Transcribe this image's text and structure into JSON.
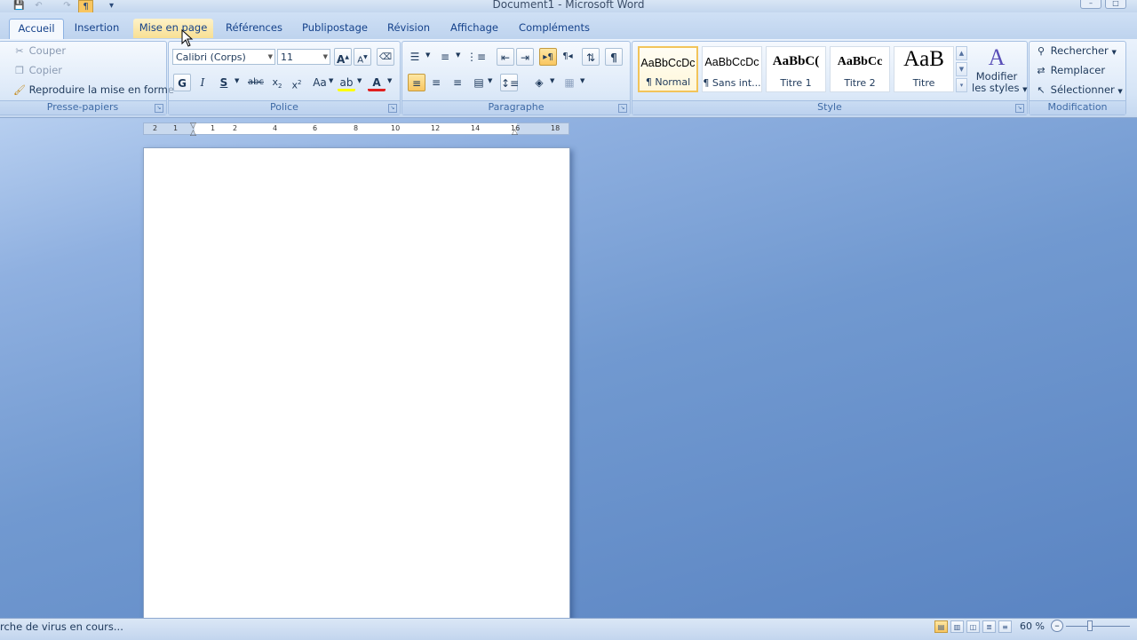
{
  "window": {
    "title": "Document1 - Microsoft Word"
  },
  "tabs": [
    {
      "label": "Accueil",
      "state": "active"
    },
    {
      "label": "Insertion",
      "state": "normal"
    },
    {
      "label": "Mise en page",
      "state": "hover"
    },
    {
      "label": "Références",
      "state": "normal"
    },
    {
      "label": "Publipostage",
      "state": "normal"
    },
    {
      "label": "Révision",
      "state": "normal"
    },
    {
      "label": "Affichage",
      "state": "normal"
    },
    {
      "label": "Compléments",
      "state": "normal"
    }
  ],
  "clipboard": {
    "label": "Presse-papiers",
    "cut": "Couper",
    "copy": "Copier",
    "format_painter": "Reproduire la mise en forme"
  },
  "font": {
    "label": "Police",
    "family": "Calibri (Corps)",
    "size": "11",
    "bold": "G",
    "italic": "I",
    "underline": "S",
    "strike": "abc",
    "case": "Aa"
  },
  "paragraph": {
    "label": "Paragraphe",
    "show_marks": "¶"
  },
  "styles": {
    "label": "Style",
    "items": [
      {
        "sample": "AaBbCcDc",
        "name": "¶ Normal",
        "selected": true
      },
      {
        "sample": "AaBbCcDc",
        "name": "¶ Sans int...",
        "selected": false
      },
      {
        "sample": "AaBbC(",
        "name": "Titre 1",
        "selected": false
      },
      {
        "sample": "AaBbCc",
        "name": "Titre 2",
        "selected": false
      },
      {
        "sample": "AaB",
        "name": "Titre",
        "selected": false
      }
    ],
    "modify_line1": "Modifier",
    "modify_line2": "les styles"
  },
  "editing": {
    "label": "Modification",
    "find": "Rechercher",
    "replace": "Remplacer",
    "select": "Sélectionner"
  },
  "ruler": {
    "labels": [
      "2",
      "1",
      "1",
      "2",
      "4",
      "6",
      "8",
      "10",
      "12",
      "14",
      "16",
      "18"
    ]
  },
  "status": {
    "text": "rche de virus en cours...",
    "zoom": "60 %"
  },
  "colors": {
    "accent": "#15428b",
    "highlight": "#f9c660",
    "workspace": "#5a85c0"
  }
}
